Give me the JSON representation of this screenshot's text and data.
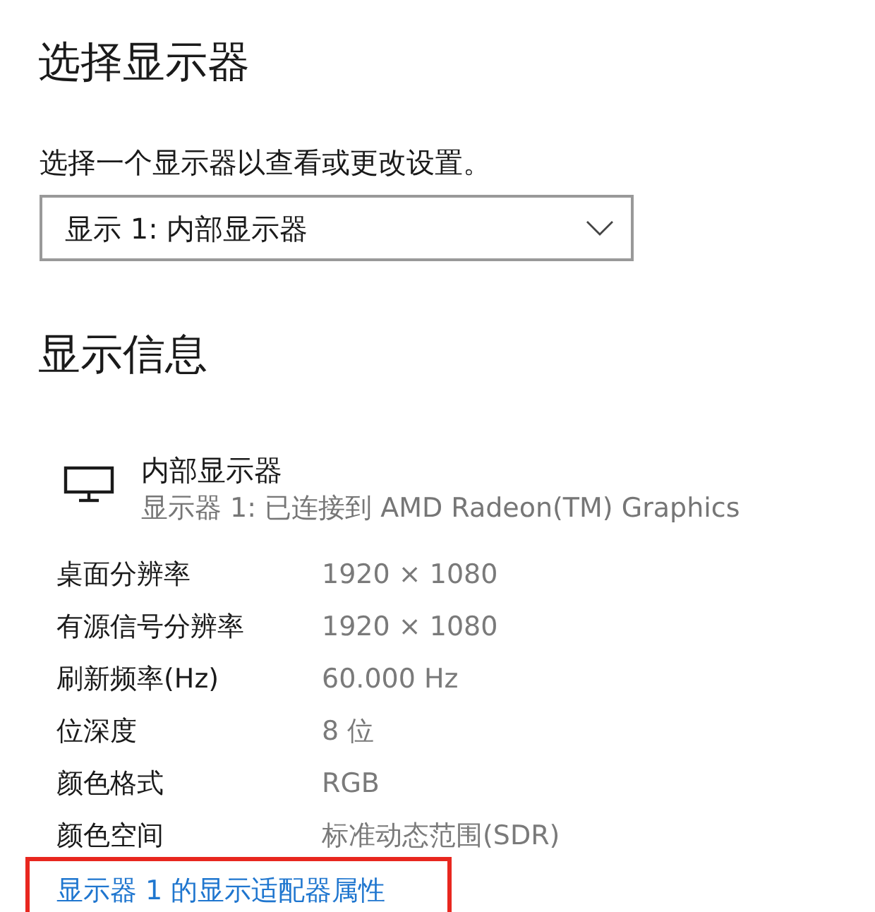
{
  "select_display": {
    "title": "选择显示器",
    "description": "选择一个显示器以查看或更改设置。",
    "dropdown": {
      "value": "显示 1: 内部显示器"
    }
  },
  "display_info": {
    "title": "显示信息",
    "display": {
      "name": "内部显示器",
      "subtitle": "显示器 1: 已连接到 AMD Radeon(TM) Graphics"
    },
    "properties": [
      {
        "label": "桌面分辨率",
        "value": "1920 × 1080"
      },
      {
        "label": "有源信号分辨率",
        "value": "1920 × 1080"
      },
      {
        "label": "刷新频率(Hz)",
        "value": "60.000 Hz"
      },
      {
        "label": "位深度",
        "value": "8 位"
      },
      {
        "label": "颜色格式",
        "value": "RGB"
      },
      {
        "label": "颜色空间",
        "value": "标准动态范围(SDR)"
      }
    ],
    "link": {
      "text": "显示器 1 的显示适配器属性",
      "highlighted": true
    }
  }
}
